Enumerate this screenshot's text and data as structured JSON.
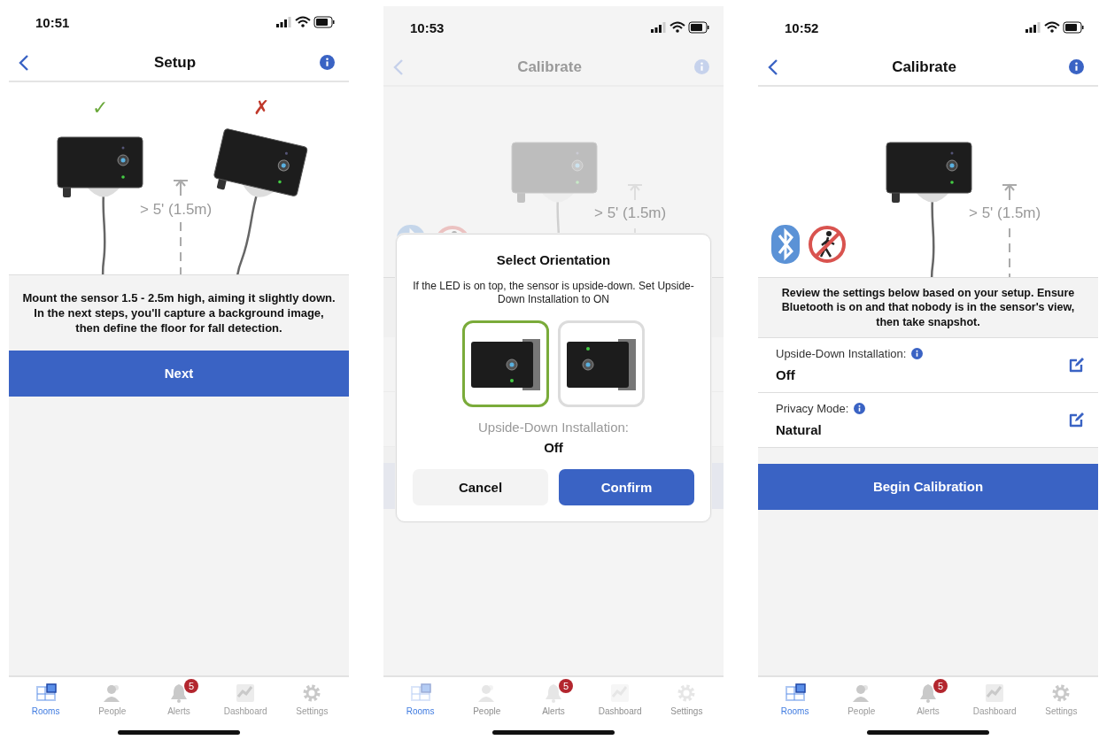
{
  "screens": [
    {
      "time": "10:51",
      "title": "Setup",
      "dimmed": false,
      "illustration": {
        "kind": "two-sensors",
        "good_mark": "✓",
        "bad_mark": "✗",
        "height_label": "> 5' (1.5m)"
      },
      "message": "Mount the sensor 1.5 - 2.5m high, aiming it slightly down. In the next steps, you'll capture a background image, then define the floor for fall detection.",
      "primary_button": "Next",
      "tabs": [
        {
          "kind": "rooms",
          "label": "Rooms",
          "selected": true
        },
        {
          "kind": "people",
          "label": "People",
          "selected": false
        },
        {
          "kind": "alerts",
          "label": "Alerts",
          "selected": false,
          "badge": "5"
        },
        {
          "kind": "dashboard",
          "label": "Dashboard",
          "selected": false
        },
        {
          "kind": "settings",
          "label": "Settings",
          "selected": false
        }
      ]
    },
    {
      "time": "10:53",
      "title": "Calibrate",
      "dimmed": true,
      "illustration": {
        "kind": "single-sensor",
        "height_label": "> 5' (1.5m)"
      },
      "dialog": {
        "title": "Select Orientation",
        "text": "If the LED is on top, the sensor is upside-down. Set Upside-Down Installation to ON",
        "options": [
          {
            "kind": "led-bottom",
            "selected": true
          },
          {
            "kind": "led-top",
            "selected": false
          }
        ],
        "setting_label": "Upside-Down Installation:",
        "setting_value": "Off",
        "buttons": [
          {
            "kind": "secondary",
            "label": "Cancel"
          },
          {
            "kind": "primary",
            "label": "Confirm"
          }
        ]
      },
      "tabs": [
        {
          "kind": "rooms",
          "label": "Rooms",
          "selected": true
        },
        {
          "kind": "people",
          "label": "People",
          "selected": false
        },
        {
          "kind": "alerts",
          "label": "Alerts",
          "selected": false,
          "badge": "5"
        },
        {
          "kind": "dashboard",
          "label": "Dashboard",
          "selected": false
        },
        {
          "kind": "settings",
          "label": "Settings",
          "selected": false
        }
      ]
    },
    {
      "time": "10:52",
      "title": "Calibrate",
      "dimmed": false,
      "illustration": {
        "kind": "single-sensor",
        "height_label": "> 5' (1.5m)"
      },
      "message": "Review the settings below based on your setup. Ensure Bluetooth is on and that nobody is in the sensor's view, then take snapshot.",
      "settings": [
        {
          "label": "Upside-Down Installation:",
          "value": "Off"
        },
        {
          "label": "Privacy Mode:",
          "value": "Natural"
        }
      ],
      "primary_button": "Begin Calibration",
      "tabs": [
        {
          "kind": "rooms",
          "label": "Rooms",
          "selected": true
        },
        {
          "kind": "people",
          "label": "People",
          "selected": false
        },
        {
          "kind": "alerts",
          "label": "Alerts",
          "selected": false,
          "badge": "5"
        },
        {
          "kind": "dashboard",
          "label": "Dashboard",
          "selected": false
        },
        {
          "kind": "settings",
          "label": "Settings",
          "selected": false
        }
      ]
    }
  ]
}
